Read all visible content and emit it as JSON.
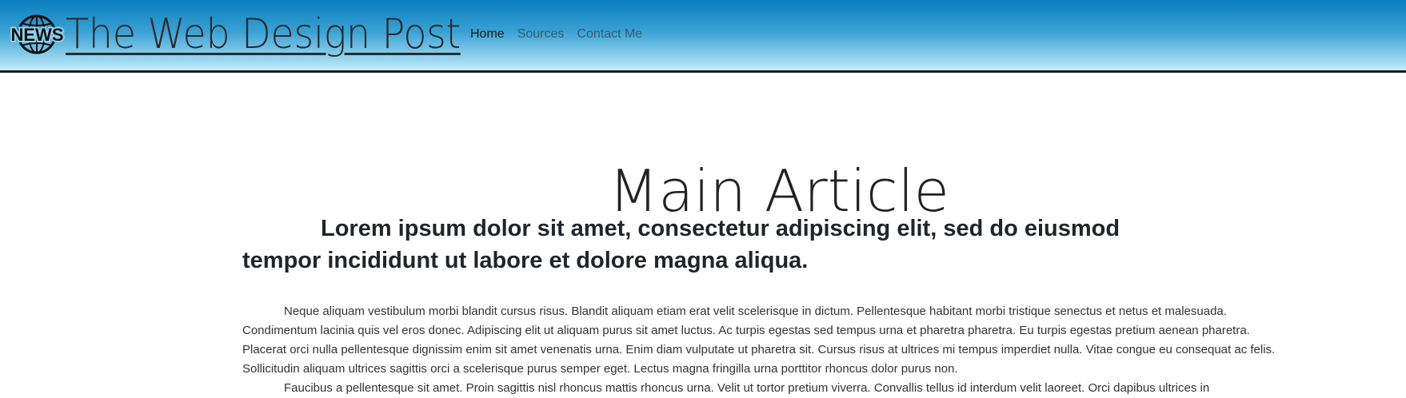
{
  "header": {
    "logo_text": "NEWS",
    "brand": "The Web Design Post",
    "nav": [
      {
        "label": "Home",
        "active": true
      },
      {
        "label": "Sources",
        "active": false
      },
      {
        "label": "Contact Me",
        "active": false
      }
    ]
  },
  "article": {
    "title": "Main Article",
    "subtitle": "Lorem ipsum dolor sit amet, consectetur adipiscing elit, sed do eiusmod tempor incididunt ut labore et dolore magna aliqua.",
    "paragraphs": [
      "Neque aliquam vestibulum morbi blandit cursus risus. Blandit aliquam etiam erat velit scelerisque in dictum. Pellentesque habitant morbi tristique senectus et netus et malesuada. Condimentum lacinia quis vel eros donec. Adipiscing elit ut aliquam purus sit amet luctus. Ac turpis egestas sed tempus urna et pharetra pharetra. Eu turpis egestas pretium aenean pharetra. Placerat orci nulla pellentesque dignissim enim sit amet venenatis urna. Enim diam vulputate ut pharetra sit. Cursus risus at ultrices mi tempus imperdiet nulla. Vitae congue eu consequat ac felis. Sollicitudin aliquam ultrices sagittis orci a scelerisque purus semper eget. Lectus magna fringilla urna porttitor rhoncus dolor purus non.",
      "Faucibus a pellentesque sit amet. Proin sagittis nisl rhoncus mattis rhoncus urna. Velit ut tortor pretium viverra. Convallis tellus id interdum velit laoreet. Orci dapibus ultrices in"
    ]
  },
  "colors": {
    "header_top": "#0a7fc0",
    "header_bottom": "#c5ecf8",
    "text": "#212529"
  },
  "icons": {
    "logo": "news-globe-icon"
  }
}
